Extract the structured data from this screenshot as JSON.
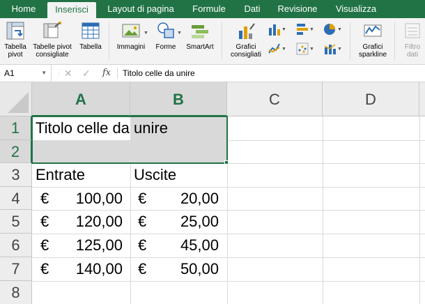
{
  "tabs": [
    "Home",
    "Inserisci",
    "Layout di pagina",
    "Formule",
    "Dati",
    "Revisione",
    "Visualizza"
  ],
  "active_tab": "Inserisci",
  "ribbon": {
    "tabella_pivot": [
      "Tabella",
      "pivot"
    ],
    "tabelle_pivot_consigliate": [
      "Tabelle pivot",
      "consigliate"
    ],
    "tabella": "Tabella",
    "immagini": "Immagini",
    "forme": "Forme",
    "smartart": "SmartArt",
    "grafici_consigliati": [
      "Grafici",
      "consigliati"
    ],
    "grafici_sparkline": [
      "Grafici",
      "sparkline"
    ],
    "filtro_dati": [
      "Filtro",
      "dati"
    ]
  },
  "formula_bar": {
    "name_box": "A1",
    "fx": "fx",
    "content": "Titolo celle da unire"
  },
  "columns": [
    "A",
    "B",
    "C",
    "D"
  ],
  "rows": [
    "1",
    "2",
    "3",
    "4",
    "5",
    "6",
    "7",
    "8"
  ],
  "cells": {
    "A1": "Titolo celle da unire",
    "A3": "Entrate",
    "B3": "Uscite",
    "currency": "€",
    "entrate": [
      "100,00",
      "120,00",
      "125,00",
      "140,00"
    ],
    "uscite": [
      "20,00",
      "25,00",
      "45,00",
      "50,00"
    ]
  },
  "colors": {
    "excel_green": "#217346",
    "selection_fill": "#d9d9d9"
  }
}
